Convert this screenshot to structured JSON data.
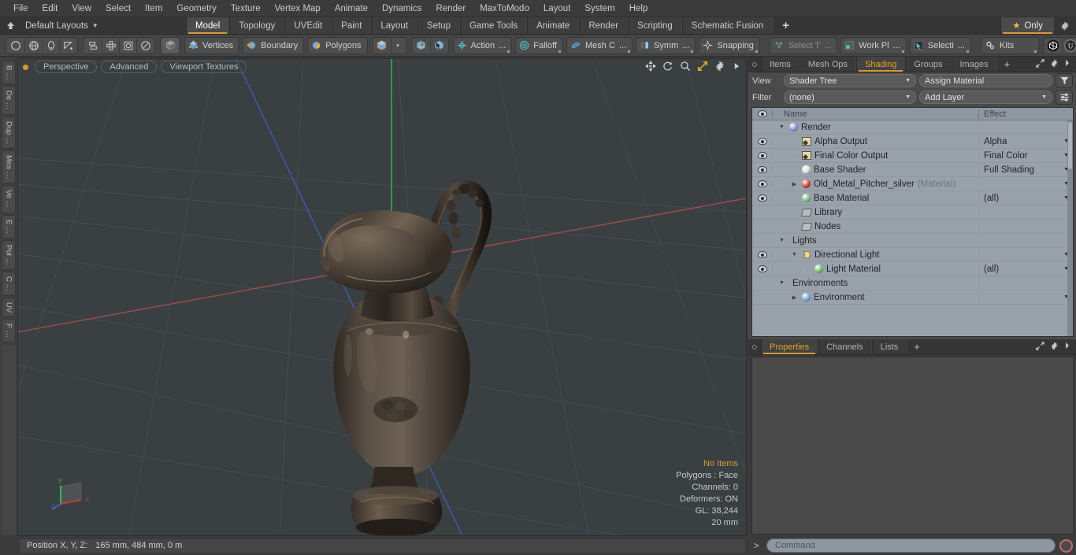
{
  "menubar": {
    "items": [
      "File",
      "Edit",
      "View",
      "Select",
      "Item",
      "Geometry",
      "Texture",
      "Vertex Map",
      "Animate",
      "Dynamics",
      "Render",
      "MaxToModo",
      "Layout",
      "System",
      "Help"
    ]
  },
  "layoutbar": {
    "home_icon": "home-icon",
    "layouts_label": "Default Layouts",
    "tabs": [
      "Model",
      "Topology",
      "UVEdit",
      "Paint",
      "Layout",
      "Setup",
      "Game Tools",
      "Animate",
      "Render",
      "Scripting",
      "Schematic Fusion"
    ],
    "active_tab": "Model",
    "plus_label": "+",
    "only_label": "Only",
    "star_icon": "star-icon",
    "gear_icon": "gear-icon"
  },
  "toolbar": {
    "shape_tools": [
      "circle-icon",
      "globe-icon",
      "pen-icon",
      "curve-icon"
    ],
    "mesh_tools": [
      "mirror-icon",
      "array-icon",
      "bevel-icon",
      "radial-icon"
    ],
    "solid_icon": "solid-cube-icon",
    "selection_modes": [
      {
        "label": "Vertices",
        "icon": "vertices-cube-icon"
      },
      {
        "label": "Boundary",
        "icon": "boundary-cube-icon"
      },
      {
        "label": "Polygons",
        "icon": "polygons-cube-icon"
      }
    ],
    "item_mode_icon": "item-cube-icon",
    "item_mode_caret": "▾",
    "snap_icons": [
      "element-move-icon",
      "element-select-icon"
    ],
    "items": [
      {
        "label": "Action",
        "suffix": "...",
        "icon": "action-center-icon",
        "dim": false
      },
      {
        "label": "Falloff",
        "suffix": "",
        "icon": "falloff-icon",
        "dim": false
      },
      {
        "label": "Mesh C",
        "suffix": "...",
        "icon": "mesh-constraint-icon",
        "dim": false
      },
      {
        "label": "Symm",
        "suffix": "...",
        "icon": "symmetry-icon",
        "dim": false
      },
      {
        "label": "Snapping",
        "suffix": "",
        "icon": "snapping-icon",
        "dim": false
      },
      {
        "label": "Select T",
        "suffix": "...",
        "icon": "select-through-icon",
        "dim": true
      },
      {
        "label": "Work Pl",
        "suffix": "...",
        "icon": "work-plane-icon",
        "dim": false
      },
      {
        "label": "Selecti",
        "suffix": "...",
        "icon": "selection-set-icon",
        "dim": false
      },
      {
        "label": "Kits",
        "suffix": "",
        "icon": "kits-gears-icon",
        "dim": false
      }
    ],
    "right_icons": [
      "modo-logo-icon",
      "unreal-logo-icon"
    ]
  },
  "left_strip": {
    "tabs": [
      "B …",
      "De …",
      "Dup …",
      "Mes …",
      "Ve …",
      "E …",
      "Pol …",
      "C …",
      "UV",
      "F …"
    ]
  },
  "viewport": {
    "dot": "viewport-active-dot",
    "pills": [
      "Perspective",
      "Advanced",
      "Viewport Textures"
    ],
    "nav_icons": [
      "pan-icon",
      "rotate-icon",
      "zoom-icon",
      "fit-icon",
      "gear-icon",
      "play-icon"
    ],
    "hud": {
      "no_items": "No Items",
      "polygons": "Polygons : Face",
      "channels": "Channels: 0",
      "deformers": "Deformers: ON",
      "gl": "GL: 38,244",
      "scale": "20 mm"
    },
    "gizmo": {
      "x": "X",
      "y": "Y",
      "z": "Z"
    },
    "colors": {
      "background": "#3a3f42",
      "axis_x": "#b04a4a",
      "axis_y": "#3fbf50",
      "axis_z": "#4a6fd0",
      "model": "#4a4038"
    }
  },
  "shading_panel": {
    "tabs": [
      "Items",
      "Mesh Ops",
      "Shading",
      "Groups",
      "Images"
    ],
    "active_tab": "Shading",
    "plus_label": "+",
    "header_icons": [
      "expand-icon",
      "gear-icon",
      "chevron-right-icon"
    ],
    "view_label": "View",
    "view_value": "Shader Tree",
    "assign_material": "Assign Material",
    "filter_label": "Filter",
    "filter_value": "(none)",
    "add_layer": "Add Layer",
    "filter_icon": "funnel-icon",
    "options_icon": "sliders-icon",
    "columns": {
      "eye": "visibility-icon",
      "name": "Name",
      "effect": "Effect"
    },
    "rows": [
      {
        "name": "Render",
        "effect": "",
        "depth": 1,
        "eye": false,
        "disclosure": "open",
        "icon": "sphere",
        "icon_color": "#8a92d8",
        "sub": ""
      },
      {
        "name": "Alpha Output",
        "effect": "Alpha",
        "depth": 2,
        "eye": true,
        "disclosure": "leaf",
        "icon": "image",
        "icon_color": "",
        "sub": ""
      },
      {
        "name": "Final Color Output",
        "effect": "Final Color",
        "depth": 2,
        "eye": true,
        "disclosure": "leaf",
        "icon": "image",
        "icon_color": "",
        "sub": ""
      },
      {
        "name": "Base Shader",
        "effect": "Full Shading",
        "depth": 2,
        "eye": true,
        "disclosure": "leaf",
        "icon": "sphere",
        "icon_color": "#dcdcdc",
        "sub": ""
      },
      {
        "name": "Old_Metal_Pitcher_silver",
        "effect": "",
        "depth": 2,
        "eye": true,
        "disclosure": "closed",
        "icon": "sphere",
        "icon_color": "#cc3b3b",
        "sub": "(Material)"
      },
      {
        "name": "Base Material",
        "effect": "(all)",
        "depth": 2,
        "eye": true,
        "disclosure": "leaf",
        "icon": "sphere",
        "icon_color": "#7fbf7f",
        "sub": ""
      },
      {
        "name": "Library",
        "effect": "",
        "depth": 2,
        "eye": false,
        "disclosure": "none",
        "icon": "folder",
        "icon_color": "",
        "sub": ""
      },
      {
        "name": "Nodes",
        "effect": "",
        "depth": 2,
        "eye": false,
        "disclosure": "none",
        "icon": "folder",
        "icon_color": "",
        "sub": ""
      },
      {
        "name": "Lights",
        "effect": "",
        "depth": 1,
        "eye": false,
        "disclosure": "open",
        "icon": "none",
        "icon_color": "",
        "sub": ""
      },
      {
        "name": "Directional Light",
        "effect": "",
        "depth": 2,
        "eye": true,
        "disclosure": "open",
        "icon": "light",
        "icon_color": "#e8d88a",
        "sub": ""
      },
      {
        "name": "Light Material",
        "effect": "(all)",
        "depth": 3,
        "eye": true,
        "disclosure": "leaf",
        "icon": "sphere",
        "icon_color": "#6fbf6f",
        "sub": ""
      },
      {
        "name": "Environments",
        "effect": "",
        "depth": 1,
        "eye": false,
        "disclosure": "open",
        "icon": "none",
        "icon_color": "",
        "sub": ""
      },
      {
        "name": "Environment",
        "effect": "",
        "depth": 2,
        "eye": false,
        "disclosure": "closed",
        "icon": "sphere",
        "icon_color": "#6fa8d8",
        "sub": ""
      }
    ]
  },
  "properties_panel": {
    "tabs": [
      "Properties",
      "Channels",
      "Lists"
    ],
    "active_tab": "Properties",
    "plus_label": "+",
    "header_icons": [
      "expand-icon",
      "gear-icon",
      "chevron-right-icon"
    ]
  },
  "statusbar": {
    "position_label": "Position X, Y, Z:",
    "position_value": "165 mm, 484 mm, 0 m"
  },
  "commandbar": {
    "prompt": ">",
    "placeholder": "Command",
    "record_icon": "record-circle-icon"
  }
}
